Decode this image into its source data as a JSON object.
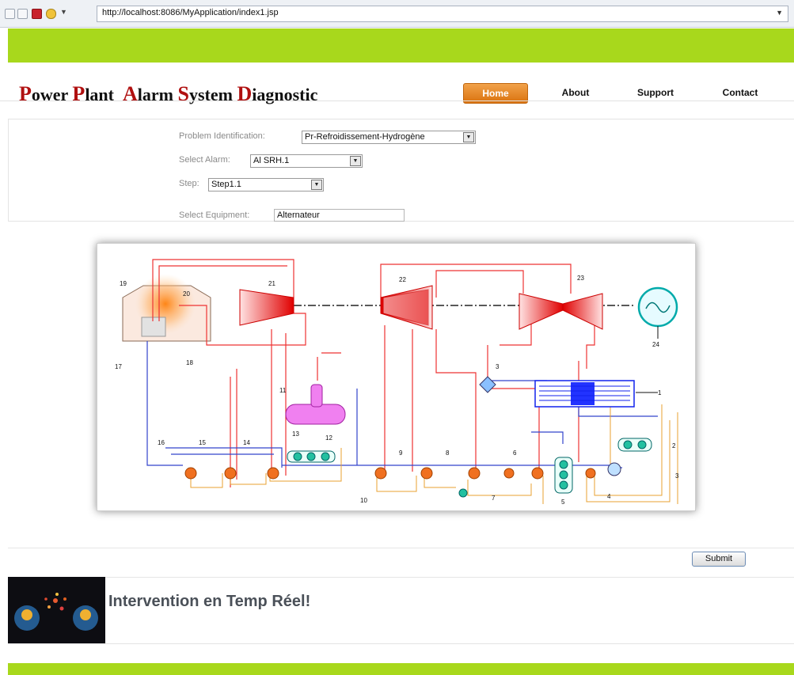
{
  "browser": {
    "url": "http://localhost:8086/MyApplication/index1.jsp"
  },
  "header": {
    "title_parts": [
      {
        "cap": "P",
        "rest": "ower "
      },
      {
        "cap": "P",
        "rest": "lant  "
      },
      {
        "cap": "A",
        "rest": "larm "
      },
      {
        "cap": "S",
        "rest": "ystem "
      },
      {
        "cap": "D",
        "rest": "iagnostic"
      }
    ],
    "nav": {
      "home": "Home",
      "about": "About",
      "support": "Support",
      "contact": "Contact"
    }
  },
  "form": {
    "problem": {
      "label": "Problem Identification:",
      "value": "Pr-Refroidissement-Hydrogène"
    },
    "alarm": {
      "label": "Select Alarm:",
      "value": "Al SRH.1"
    },
    "step": {
      "label": "Step:",
      "value": "Step1.1"
    },
    "equipment": {
      "label": "Select Equipment:",
      "value": "Alternateur"
    }
  },
  "diagram": {
    "labels": [
      "1",
      "2",
      "3",
      "4",
      "5",
      "6",
      "7",
      "8",
      "9",
      "10",
      "11",
      "12",
      "13",
      "14",
      "15",
      "16",
      "17",
      "18",
      "19",
      "20",
      "21",
      "22",
      "23",
      "24",
      "3"
    ]
  },
  "actions": {
    "submit": "Submit"
  },
  "promo": {
    "text": "Intervention en Temp Réel!"
  },
  "colors": {
    "accent_green": "#a8d81c",
    "nav_active": "#e0801a",
    "title_caps": "#b01010"
  }
}
